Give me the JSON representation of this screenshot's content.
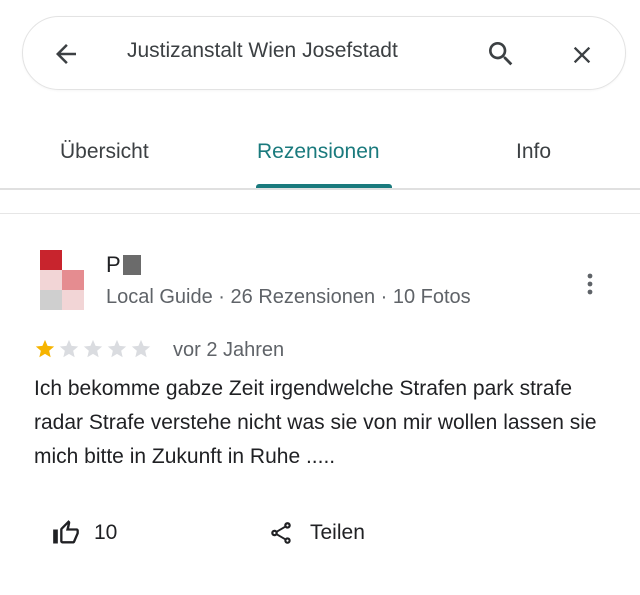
{
  "search": {
    "query": "Justizanstalt Wien Josefstadt"
  },
  "icons": {
    "back": "arrow-back-icon",
    "search": "search-icon",
    "close": "close-icon",
    "more": "more-vertical-icon",
    "like": "thumb-up-icon",
    "share": "share-icon"
  },
  "tabs": [
    {
      "label": "Übersicht",
      "active": false
    },
    {
      "label": "Rezensionen",
      "active": true
    },
    {
      "label": "Info",
      "active": false
    }
  ],
  "colors": {
    "accent": "#1a7a7d",
    "star_filled": "#f6b400",
    "star_empty": "#dadce0",
    "avatar_red": "#c8242d",
    "avatar_pink": "#e58c90",
    "avatar_light": "#f2d5d6",
    "avatar_grey": "#cfcfcf"
  },
  "review": {
    "reviewer_initial": "P",
    "reviewer_meta": "Local Guide · 26 Rezensionen · 10 Fotos",
    "rating": 1,
    "rating_max": 5,
    "date": "vor 2 Jahren",
    "text": "Ich bekomme gabze Zeit irgendwelche Strafen park strafe radar Strafe verstehe nicht was sie von mir wollen lassen sie mich bitte in Zukunft in Ruhe .....",
    "likes": "10",
    "share_label": "Teilen"
  }
}
